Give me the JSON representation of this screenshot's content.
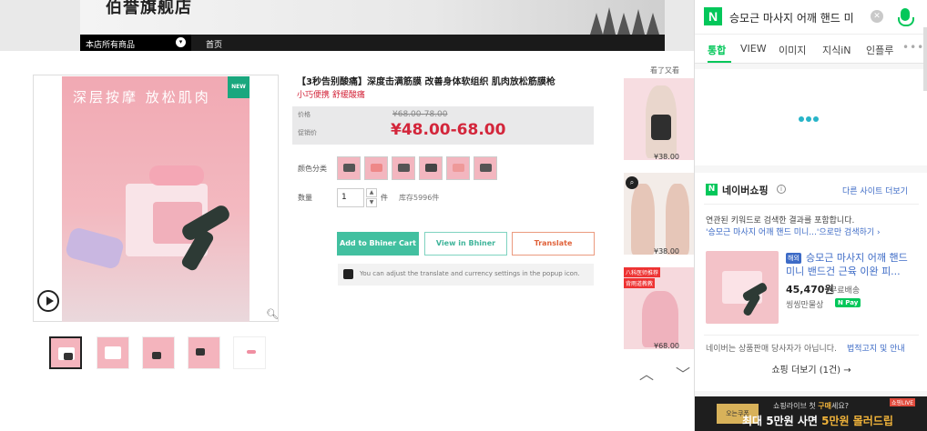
{
  "store": {
    "name": "伯誉旗舰店",
    "nav_all": "本店所有商品",
    "nav_home": "首页"
  },
  "product": {
    "image_text": "深层按摩 放松肌肉",
    "new_badge": "NEW",
    "title": "【3秒告别酸痛】深度击满筋膜 改善身体软组织 肌肉放松筋膜枪",
    "subtitle": "小巧便携 舒缓酸痛",
    "orig_label": "价格",
    "promo_label": "促销价",
    "orig_price": "¥68.00-78.00",
    "promo_price": "¥48.00-68.00",
    "color_label": "颜色分类",
    "qty_label": "数量",
    "qty_value": "1",
    "qty_unit": "件",
    "stock": "库存5996件",
    "btn_cart": "Add to Bhiner Cart",
    "btn_view": "View in Bhiner",
    "btn_translate": "Translate",
    "hint": "You can adjust the translate and currency settings in the popup icon."
  },
  "recommend": {
    "header": "看了又看",
    "prices": [
      "¥38.00",
      "¥38.00",
      "¥68.00"
    ],
    "third_tags": [
      "八科医师推荐",
      "背雨道教教"
    ]
  },
  "naver": {
    "query": "승모근 마사지 어깨 핸드 미",
    "tabs": [
      "통합",
      "VIEW",
      "이미지",
      "지식iN",
      "인플루"
    ],
    "more": "•••",
    "shop_title": "네이버쇼핑",
    "info": "i",
    "other_sites": "다른 사이트 더보기",
    "note1": "연관된 키워드로 검색한 결과를 포함합니다.",
    "note2": "'승모근 마사지 어깨 핸드 미니...'으로만 검색하기 ›",
    "ad_tag": "해외",
    "prod_name": "승모근 마사지 어깨 핸드 미니 밴드건 근육 이완 피...",
    "prod_price": "45,470원",
    "shipping": "무료배송",
    "seller": "씽씽만물상",
    "npay": "N Pay",
    "disclaimer": "네이버는 상품판매 당사자가 아닙니다.",
    "disclaimer_link": "법적고지 및 안내",
    "shop_more": "쇼핑 더보기 (1건) →",
    "ad_box": "오는쿠폰",
    "ad_line1a": "쇼핑라이브 첫 ",
    "ad_line1b": "구매",
    "ad_line1c": "세요?",
    "ad_line2a": "최대 5만원 사면 ",
    "ad_line2b": "5만원 몰러드립",
    "ad_corner": "쇼핑LIVE"
  },
  "colors": {
    "accent_green": "#03c75a",
    "price_red": "#d3263b",
    "cart_teal": "#42c0a0"
  }
}
